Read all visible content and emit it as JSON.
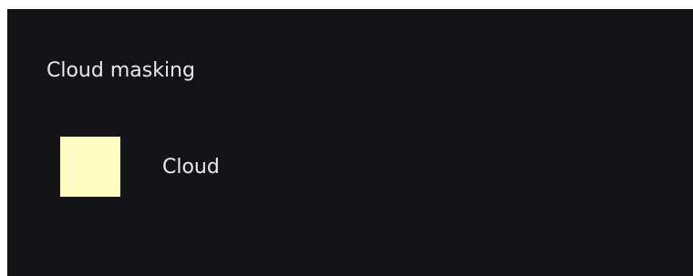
{
  "panel": {
    "title": "Cloud masking",
    "legend": [
      {
        "label": "Cloud",
        "color": "#fefcc0"
      }
    ]
  },
  "colors": {
    "panel_background": "#131418",
    "text": "#e7e8ea"
  }
}
